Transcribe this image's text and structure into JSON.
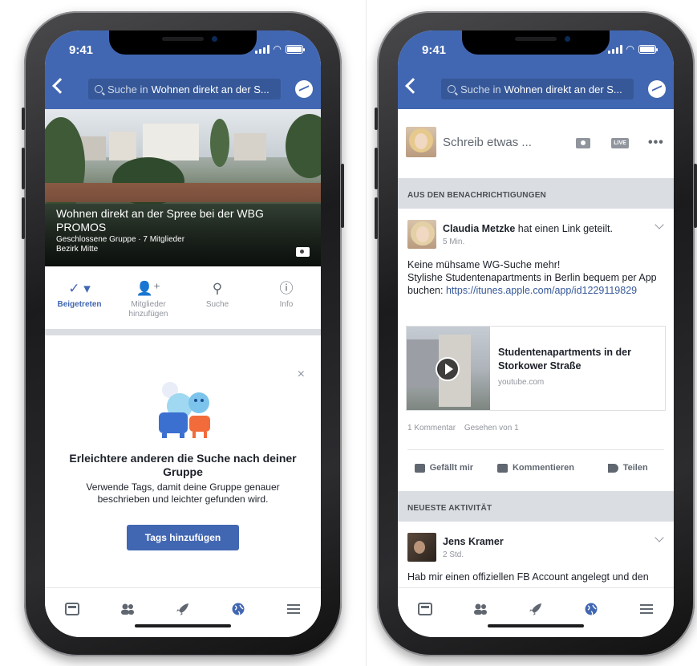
{
  "status": {
    "time": "9:41"
  },
  "left_screen": {
    "search": {
      "prefix": "Suche in",
      "query": "Wohnen direkt an der S..."
    },
    "cover": {
      "title": "Wohnen direkt an der Spree bei der WBG PROMOS",
      "subtitle": "Geschlossene Gruppe · 7 Mitglieder",
      "location": "Bezirk Mitte"
    },
    "actions": [
      {
        "label": "Beigetreten",
        "icon": "check-icon"
      },
      {
        "label": "Mitglieder hinzufügen",
        "icon": "add-member-icon"
      },
      {
        "label": "Suche",
        "icon": "search-icon"
      },
      {
        "label": "Info",
        "icon": "info-icon"
      }
    ],
    "tag_card": {
      "title": "Erleichtere anderen die Suche nach deiner Gruppe",
      "body": "Verwende Tags, damit deine Gruppe genauer beschrieben und leichter gefunden wird.",
      "button": "Tags hinzufügen",
      "close": "×"
    }
  },
  "right_screen": {
    "search": {
      "prefix": "Suche in",
      "query": "Wohnen direkt an der S..."
    },
    "composer": {
      "placeholder": "Schreib etwas ...",
      "live_label": "LIVE",
      "more": "•••"
    },
    "section_notifications": "AUS DEN BENACHRICHTIGUNGEN",
    "post1": {
      "author": "Claudia Metzke",
      "action": "hat einen Link geteilt.",
      "time": "5 Min.",
      "line1": "Keine mühsame WG-Suche mehr!",
      "line2": "Stylishe Studentenapartments in Berlin bequem per App buchen:",
      "link": "https://itunes.apple.com/app/id1229119829",
      "card_title": "Studentenapartments in der Storkower Straße",
      "card_domain": "youtube.com",
      "comments": "1 Kommentar",
      "seen": "Gesehen von 1",
      "like": "Gefällt mir",
      "comment": "Kommentieren",
      "share": "Teilen"
    },
    "section_activity": "NEUESTE AKTIVITÄT",
    "post2": {
      "author": "Jens Kramer",
      "time": "2 Std.",
      "text": "Hab mir einen offiziellen FB Account angelegt und den"
    }
  },
  "colors": {
    "brand": "#4267b2",
    "link": "#365899",
    "section_bg": "#dadde1"
  },
  "tab_icons": [
    "feed-icon",
    "members-icon",
    "rocket-icon",
    "globe-icon",
    "menu-icon"
  ]
}
